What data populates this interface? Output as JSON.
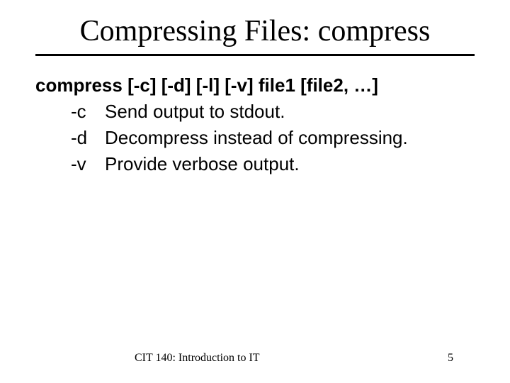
{
  "title": "Compressing Files: compress",
  "syntax": "compress [-c] [-d] [-l] [-v] file1 [file2, …]",
  "options": [
    {
      "flag": "-c",
      "desc": "Send output to stdout."
    },
    {
      "flag": "-d",
      "desc": "Decompress instead of compressing."
    },
    {
      "flag": "-v",
      "desc": "Provide verbose output."
    }
  ],
  "footer": {
    "course": "CIT 140: Introduction to IT",
    "page": "5"
  }
}
